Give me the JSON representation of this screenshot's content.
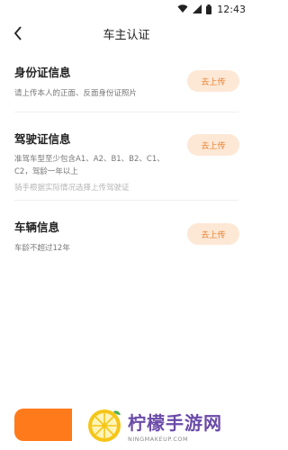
{
  "status_bar": {
    "time": "12:43"
  },
  "header": {
    "title": "车主认证"
  },
  "sections": [
    {
      "title": "身份证信息",
      "desc": "请上传本人的正面、反面身份证照片",
      "note": "",
      "button": "去上传"
    },
    {
      "title": "驾驶证信息",
      "desc_line1": "准驾车型至少包含A1、A2、B1、B2、C1、",
      "desc_line2": "C2，驾龄一年以上",
      "note": "骑手根据实际情况选择上传驾驶证",
      "button": "去上传"
    },
    {
      "title": "车辆信息",
      "desc": "车龄不超过12年",
      "note": "",
      "button": "去上传"
    }
  ],
  "watermark": {
    "brand": "柠檬手游网",
    "domain": "NINGMAKEUP.COM"
  },
  "colors": {
    "accent": "#ff7a1a",
    "button_bg": "#fde8d6",
    "button_text": "#e87f2e"
  }
}
